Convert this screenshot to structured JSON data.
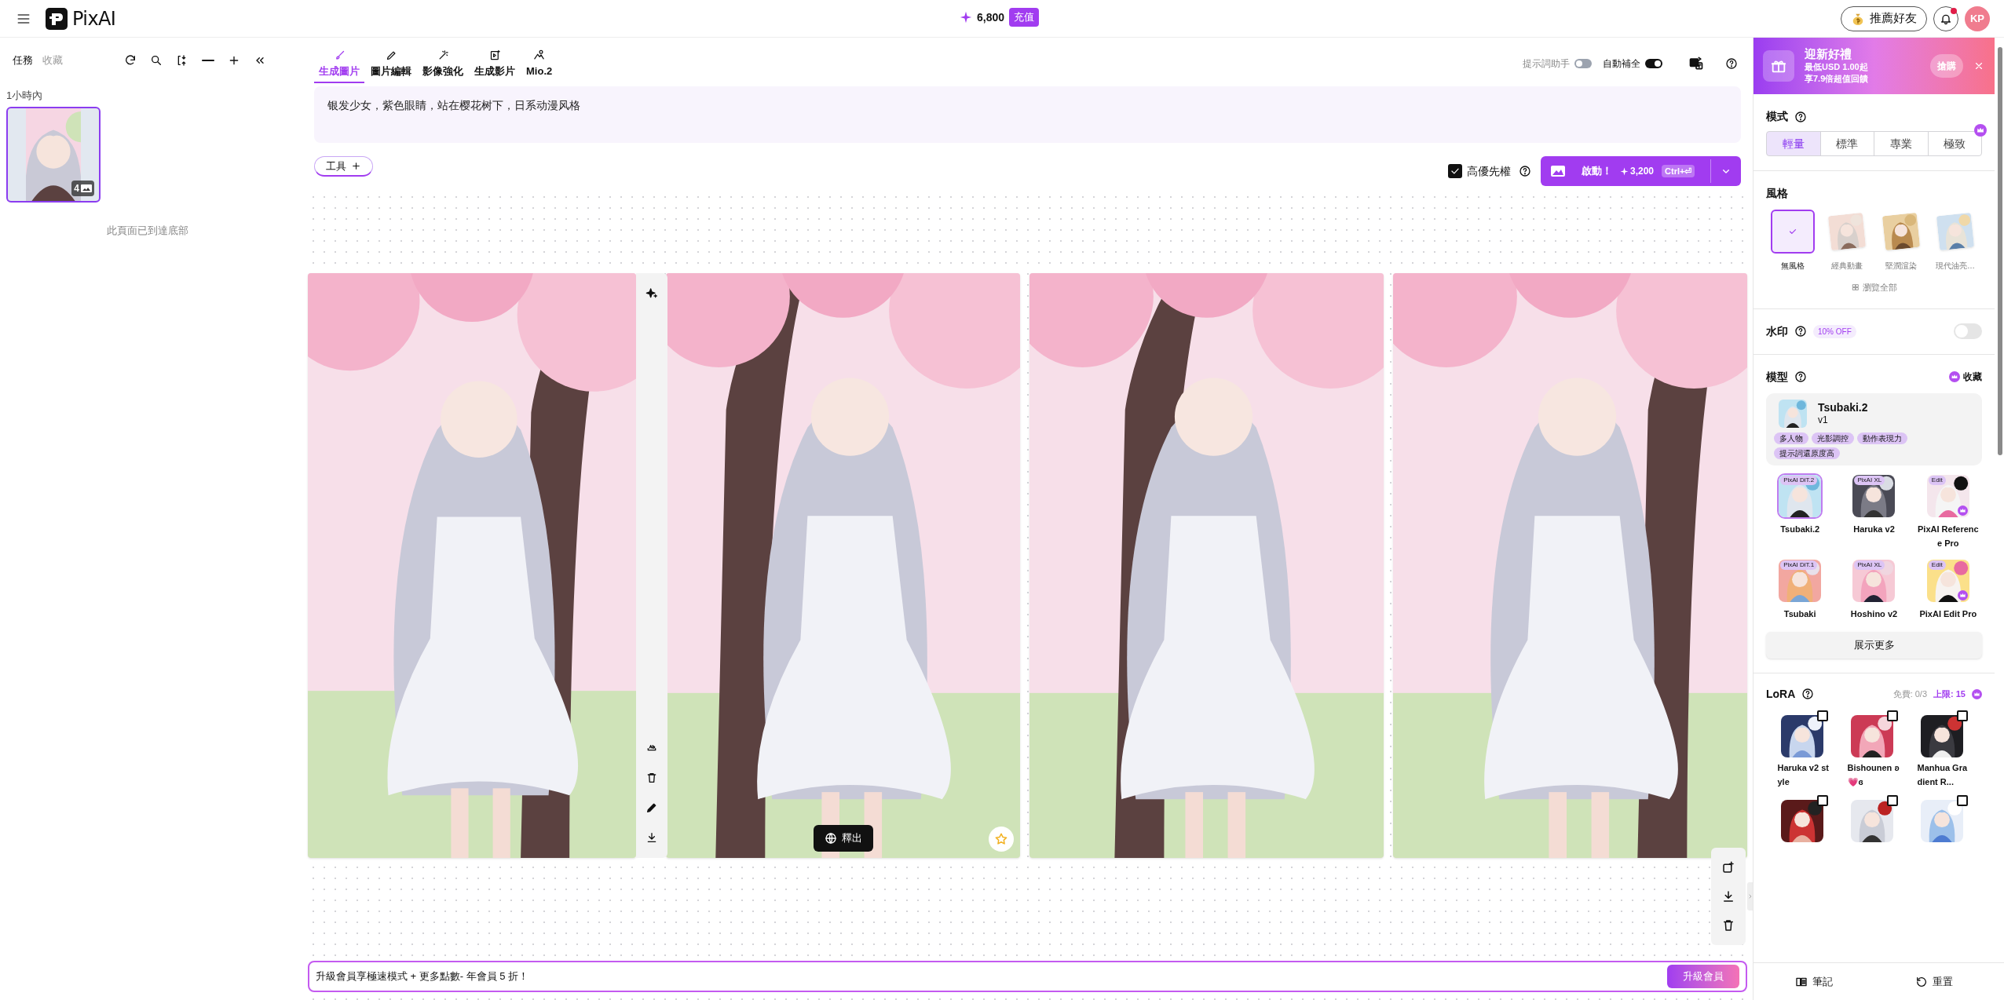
{
  "header": {
    "logo": "PixAI",
    "credits": "6,800",
    "recharge": "充值",
    "refer": "推薦好友",
    "avatar": "KP",
    "has_notification": true
  },
  "left_panel": {
    "tabs": [
      {
        "label": "任務",
        "selected": true
      },
      {
        "label": "收藏",
        "selected": false
      }
    ],
    "group_label": "1小時內",
    "tasks": [
      {
        "kind": "picture",
        "count": "4",
        "selected": true
      }
    ],
    "end_note": "此頁面已到達底部"
  },
  "main": {
    "tabs": [
      {
        "label": "生成圖片",
        "kind": "brush",
        "selected": true
      },
      {
        "label": "圖片編輯",
        "kind": "pencil",
        "selected": false
      },
      {
        "label": "影像強化",
        "kind": "wand",
        "selected": false
      },
      {
        "label": "生成影片",
        "kind": "video",
        "selected": false
      },
      {
        "label": "Mio.2",
        "kind": "mio",
        "selected": false
      }
    ],
    "toggles": [
      {
        "label": "提示詞助手",
        "on": false
      },
      {
        "label": "自動補全",
        "on": true
      }
    ],
    "prompt": "银发少女，紫色眼睛，站在樱花树下，日系动漫风格",
    "tools_button": "工具",
    "priority": {
      "label": "高優先權",
      "checked": true
    },
    "start": {
      "label": "啟動！",
      "cost": "3,200",
      "shortcut": "Ctrl+⏎"
    },
    "images": [
      {
        "kind": "picture",
        "toolbar": true
      },
      {
        "kind": "picture",
        "export": "釋出"
      },
      {
        "kind": "picture"
      },
      {
        "kind": "picture"
      }
    ],
    "upgrade": {
      "text": "升級會員享極速模式 + 更多點數- 年會員 5 折！",
      "button": "升級會員"
    }
  },
  "right_panel": {
    "promo": {
      "title": "迎新好禮",
      "lines": [
        "最低USD 1.00起",
        "享7.9倍超值回饋"
      ],
      "button": "搶購"
    },
    "mode": {
      "title": "模式",
      "options": [
        {
          "label": "輕量",
          "selected": true,
          "premium": false
        },
        {
          "label": "標準",
          "selected": false,
          "premium": false
        },
        {
          "label": "專業",
          "selected": false,
          "premium": false
        },
        {
          "label": "極致",
          "selected": false,
          "premium": true
        }
      ]
    },
    "style": {
      "title": "風格",
      "items": [
        {
          "label": "無風格",
          "kind": "none",
          "selected": true
        },
        {
          "label": "經典動畫",
          "kind": "picture",
          "selected": false
        },
        {
          "label": "堅潤渲染",
          "kind": "picture",
          "selected": false
        },
        {
          "label": "現代油亮…",
          "kind": "picture",
          "selected": false
        }
      ],
      "browse": "瀏覽全部"
    },
    "watermark": {
      "title": "水印",
      "badge": "10% OFF",
      "on": false
    },
    "model": {
      "title": "模型",
      "favorites": "收藏",
      "current": {
        "name": "Tsubaki.2",
        "version": "v1",
        "tags": [
          "多人物",
          "光影調控",
          "動作表現力",
          "提示詞還原度高"
        ]
      },
      "options": [
        {
          "name": "Tsubaki.2",
          "badge": "PixAI DiT.2",
          "selected": true,
          "premium": false
        },
        {
          "name": "Haruka v2",
          "badge": "PixAI XL",
          "selected": false,
          "premium": false
        },
        {
          "name": "PixAI Reference Pro",
          "badge": "Edit",
          "selected": false,
          "premium": true
        },
        {
          "name": "Tsubaki",
          "badge": "PixAI DiT.1",
          "selected": false,
          "premium": false
        },
        {
          "name": "Hoshino v2",
          "badge": "PixAI XL",
          "selected": false,
          "premium": false
        },
        {
          "name": "PixAI Edit Pro",
          "badge": "Edit",
          "selected": false,
          "premium": true
        }
      ],
      "more": "展示更多"
    },
    "lora": {
      "title": "LoRA",
      "free": "免費: 0/3",
      "limit": "上限: 15",
      "items": [
        {
          "name": "Haruka v2 style",
          "checked": false
        },
        {
          "name": "Bishounen ʚ💗ɞ",
          "checked": false
        },
        {
          "name": "Manhua Gradient R...",
          "checked": false
        },
        {
          "checked": false
        },
        {
          "checked": false
        },
        {
          "checked": false
        }
      ]
    },
    "footer": [
      {
        "label": "筆記",
        "kind": "notes"
      },
      {
        "label": "重置",
        "kind": "reset"
      }
    ]
  }
}
